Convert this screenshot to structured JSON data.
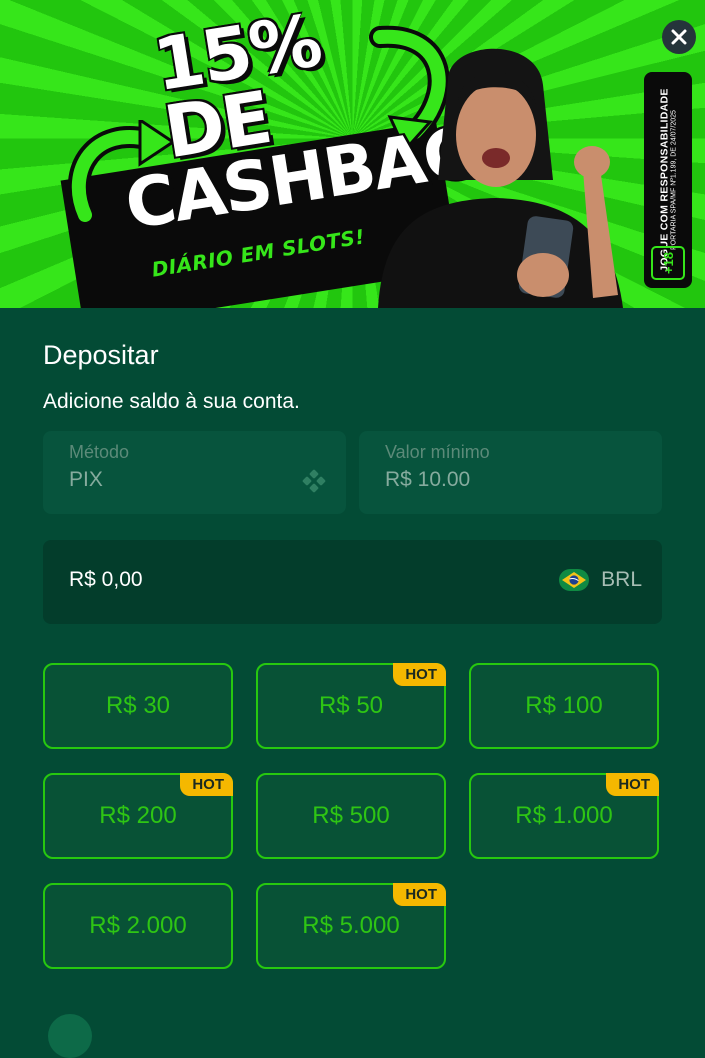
{
  "banner": {
    "headline_line1": "15% DE",
    "headline_line2": "CASHBACK",
    "tagline": "DIÁRIO EM SLOTS!",
    "responsibility_text": "JOGUE COM RESPONSABILIDADE",
    "responsibility_subtext": "PORTARIA SPA/MF Nº1.199, DE 24/07/2025",
    "age_rating": "+18",
    "close_icon": "close-icon"
  },
  "form": {
    "title": "Depositar",
    "subtitle": "Adicione saldo à sua conta.",
    "method": {
      "label": "Método",
      "value": "PIX",
      "icon": "pix-icon"
    },
    "min_value": {
      "label": "Valor mínimo",
      "value": "R$ 10.00"
    },
    "amount": {
      "value": "R$ 0,00",
      "currency": "BRL",
      "flag_icon": "brazil-flag-icon"
    },
    "hot_label": "HOT",
    "quick_amounts": [
      {
        "label": "R$ 30",
        "hot": false
      },
      {
        "label": "R$ 50",
        "hot": true
      },
      {
        "label": "R$ 100",
        "hot": false
      },
      {
        "label": "R$ 200",
        "hot": true
      },
      {
        "label": "R$ 500",
        "hot": false
      },
      {
        "label": "R$ 1.000",
        "hot": true
      },
      {
        "label": "R$ 2.000",
        "hot": false
      },
      {
        "label": "R$ 5.000",
        "hot": true
      }
    ]
  },
  "colors": {
    "background": "#034b35",
    "accent_green": "#27c80f",
    "hot_badge": "#f5b800",
    "banner_green": "#36e61a"
  }
}
